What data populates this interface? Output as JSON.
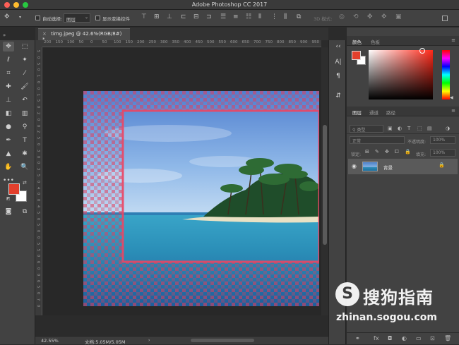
{
  "window": {
    "title": "Adobe Photoshop CC 2017"
  },
  "options_bar": {
    "auto_select_label": "自动选择:",
    "auto_select_value": "图层",
    "show_transform_label": "显示变换控件",
    "mode_3d_label": "3D 模式:"
  },
  "document": {
    "tab_label": "timg.jpeg @ 42.6%(RGB/8#) *",
    "zoom": "42.55%",
    "doc_size": "文档:5.05M/5.05M"
  },
  "ruler_h_labels": [
    "200",
    "150",
    "100",
    "50",
    "0",
    "50",
    "100",
    "150",
    "200",
    "250",
    "300",
    "350",
    "400",
    "450",
    "500",
    "550",
    "600",
    "650",
    "700",
    "750",
    "800",
    "850",
    "900",
    "950"
  ],
  "ruler_v_labels": [
    "5",
    "0",
    "5",
    "0",
    "1",
    "0",
    "0",
    "1",
    "5",
    "0",
    "2",
    "0",
    "0",
    "2",
    "5",
    "0",
    "3",
    "0",
    "0",
    "3",
    "5",
    "0",
    "4",
    "0",
    "0",
    "4",
    "5",
    "0",
    "5",
    "0",
    "0",
    "5",
    "5",
    "0",
    "6",
    "0",
    "0",
    "6",
    "5",
    "0",
    "7",
    "0"
  ],
  "color_panel": {
    "tabs": [
      "颜色",
      "色板"
    ],
    "foreground": "#e33f2c",
    "background": "#ffffff"
  },
  "layers_panel": {
    "tabs": [
      "图层",
      "通道",
      "路径"
    ],
    "filter_kind": "类型",
    "blend_mode": "正常",
    "opacity_label": "不透明度:",
    "opacity_value": "100%",
    "lock_label": "锁定:",
    "fill_label": "填充:",
    "fill_value": "100%",
    "layer_name": "背景"
  },
  "toolbox": {
    "foreground": "#e33f2c",
    "background": "#ffffff"
  },
  "watermark": {
    "brand_cn": "搜狗指南",
    "url": "zhinan.sogou.com"
  }
}
